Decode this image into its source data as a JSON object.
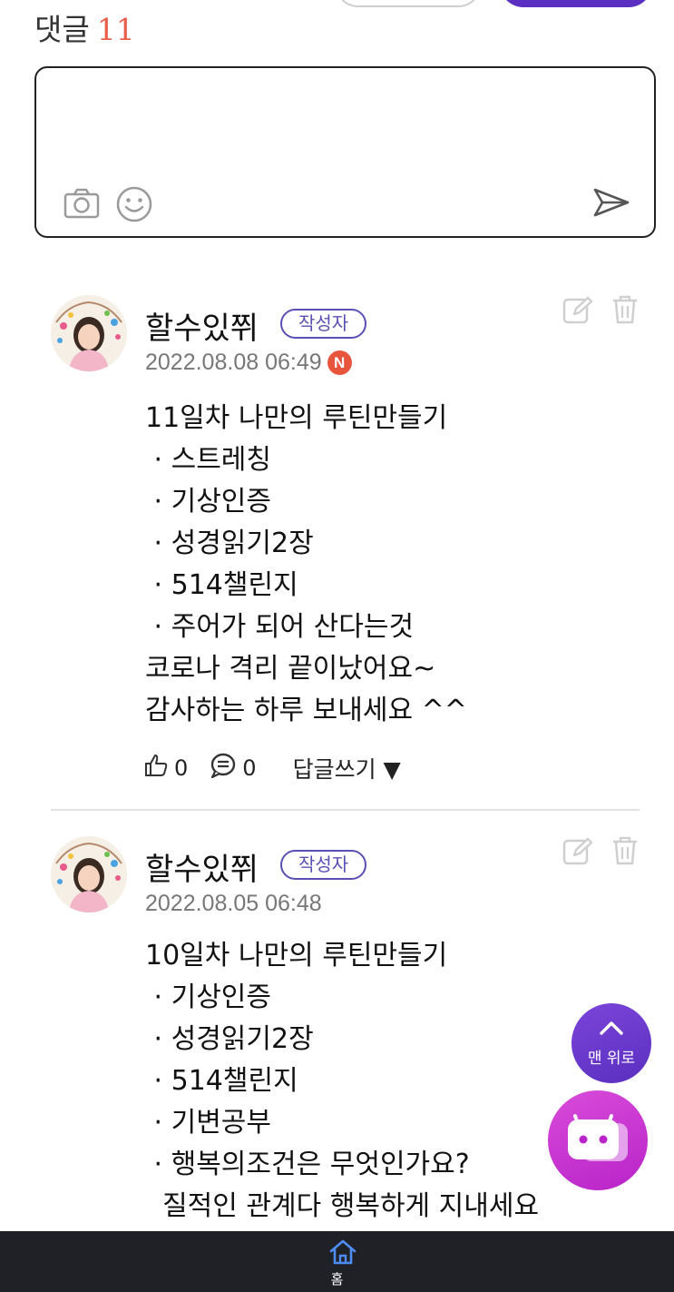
{
  "header": {
    "comment_label": "댓글",
    "comment_count": "11"
  },
  "composer": {
    "icons": [
      "camera-icon",
      "smile-icon",
      "send-icon"
    ]
  },
  "comments": [
    {
      "author": "할수있쮜",
      "badge": "작성자",
      "date": "2022.08.08 06:49",
      "new_badge": "N",
      "lines": [
        "11일차 나만의 루틴만들기",
        " · 스트레칭",
        " · 기상인증",
        " · 성경읽기2장",
        " · 514챌린지",
        " · 주어가 되어 산다는것",
        "코로나 격리 끝이났어요~",
        "감사하는 하루 보내세요 ^^"
      ],
      "likes": "0",
      "replies": "0",
      "reply_label": "답글쓰기 ▼"
    },
    {
      "author": "할수있쮜",
      "badge": "작성자",
      "date": "2022.08.05 06:48",
      "lines": [
        "10일차 나만의 루틴만들기",
        " · 기상인증",
        " · 성경읽기2장",
        " · 514챌린지",
        " · 기변공부",
        " · 행복의조건은 무엇인가요?",
        "  질적인 관계다 행복하게 지내세요"
      ]
    }
  ],
  "floating": {
    "top_label": "맨 위로"
  },
  "bottom_nav": {
    "home_label": "홈"
  },
  "colors": {
    "accent": "#5a2fc2",
    "count": "#e8604c",
    "badge": "#5a4fb3",
    "new": "#e8553d",
    "float_top": "#6a3bd0",
    "float_chat": "#c93bd0",
    "nav_bg": "#1f2127"
  }
}
